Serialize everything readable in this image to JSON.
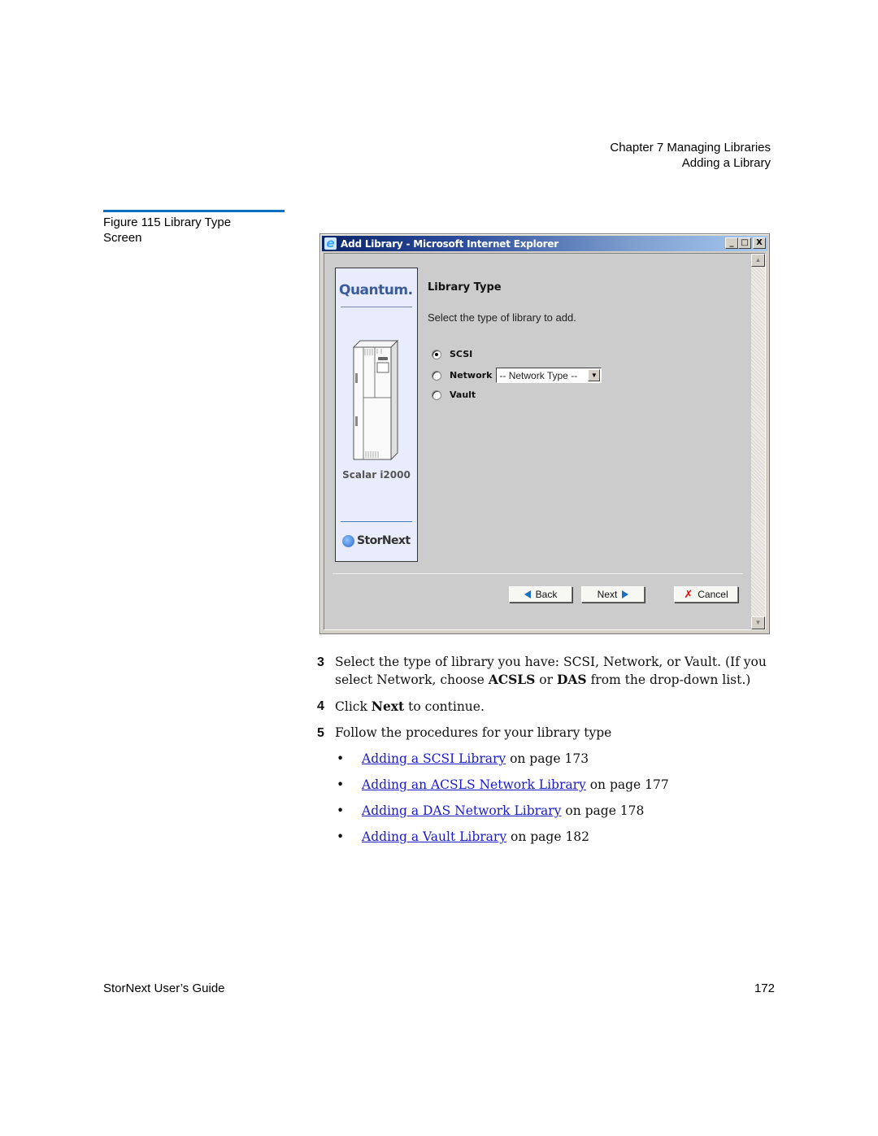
{
  "running_head": {
    "chapter": "Chapter 7  Managing Libraries",
    "section": "Adding a Library"
  },
  "figure": {
    "caption_line1": "Figure 115  Library Type",
    "caption_line2": "Screen"
  },
  "window": {
    "title": "Add Library - Microsoft Internet Explorer",
    "controls": {
      "minimize": "_",
      "maximize": "□",
      "close": "X"
    },
    "side_panel": {
      "brand": "Quantum.",
      "model": "Scalar i2000",
      "product": "StorNext"
    },
    "section_title": "Library Type",
    "instruction": "Select the type of library to add.",
    "options": [
      {
        "label": "SCSI",
        "checked": true
      },
      {
        "label": "Network",
        "checked": false
      },
      {
        "label": "Vault",
        "checked": false
      }
    ],
    "network_select": {
      "value": "-- Network Type --"
    },
    "buttons": {
      "back": "Back",
      "next": "Next",
      "cancel": "Cancel"
    }
  },
  "steps": [
    {
      "num": "3",
      "text_before": "Select the type of library you have: SCSI, Network, or Vault. (If you select Network, choose ",
      "bold1": "ACSLS",
      "mid": " or ",
      "bold2": "DAS",
      "text_after": " from the drop-down list.)"
    },
    {
      "num": "4",
      "text_before": "Click ",
      "bold1": "Next",
      "text_after": " to continue."
    },
    {
      "num": "5",
      "text": "Follow the procedures for your library type"
    }
  ],
  "links": [
    {
      "label": "Adding a SCSI Library",
      "suffix": " on page  173"
    },
    {
      "label": "Adding an ACSLS Network Library",
      "suffix": " on page  177"
    },
    {
      "label": "Adding a DAS Network Library",
      "suffix": " on page  178"
    },
    {
      "label": "Adding a Vault Library",
      "suffix": " on page  182"
    }
  ],
  "bullet_char": "•",
  "footer": {
    "guide_title": "StorNext User’s Guide",
    "page_number": "172"
  }
}
